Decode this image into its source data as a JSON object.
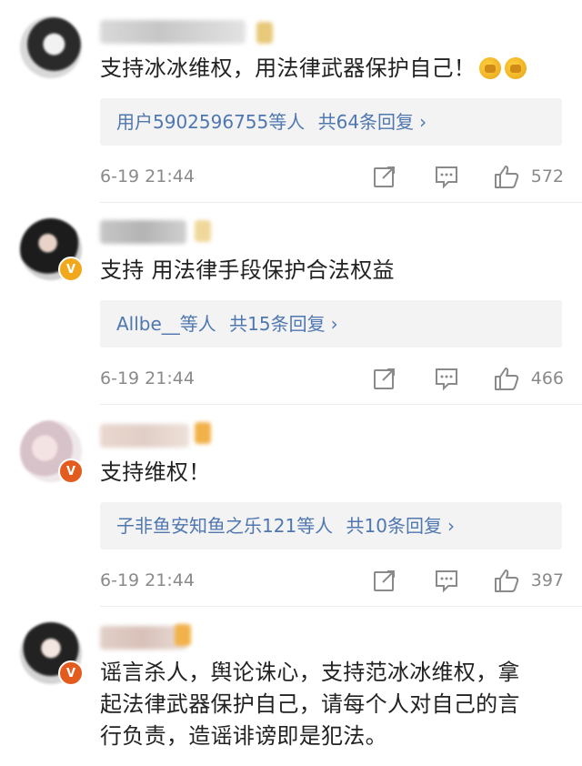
{
  "comments": [
    {
      "text": "支持冰冰维权，用法律武器保护自己！",
      "reply_users": "用户5902596755",
      "reply_mid": "等人",
      "reply_count": "共64条回复",
      "time": "6-19 21:44",
      "likes": "572"
    },
    {
      "text": "支持 用法律手段保护合法权益",
      "reply_users": "Allbe__",
      "reply_mid": "等人",
      "reply_count": "共15条回复",
      "time": "6-19 21:44",
      "likes": "466"
    },
    {
      "text": "支持维权！",
      "reply_users": "子非鱼安知鱼之乐121",
      "reply_mid": "等人",
      "reply_count": "共10条回复",
      "time": "6-19 21:44",
      "likes": "397"
    },
    {
      "text_lines": [
        "谣言杀人，舆论诛心，支持范冰冰维权，拿",
        "起法律武器保护自己，请每个人对自己的言",
        "行负责，造谣诽谤即是犯法。"
      ]
    }
  ],
  "icons": {
    "forward": "share-icon",
    "comment": "comment-icon",
    "like": "thumbs-up-icon",
    "emoji": "fist-emoji-icon",
    "verified": "verified-v-icon"
  },
  "colors": {
    "link_blue": "#4f77b0",
    "reply_bg": "#f3f3f3",
    "meta_gray": "#8a8a8a",
    "verified_red": "#e35b1f",
    "verified_gold": "#f2a81d"
  }
}
